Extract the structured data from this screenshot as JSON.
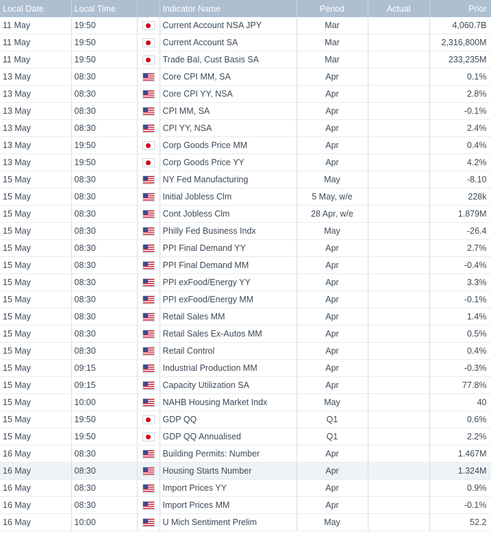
{
  "columns": {
    "date": "Local Date",
    "time": "Local Time",
    "name": "Indicator Name",
    "period": "Period",
    "actual": "Actual",
    "prior": "Prior"
  },
  "rows": [
    {
      "date": "11 May",
      "time": "19:50",
      "flag": "jp-flag-icon",
      "name": "Current Account NSA JPY",
      "period": "Mar",
      "actual": "",
      "prior": "4,060.7B"
    },
    {
      "date": "11 May",
      "time": "19:50",
      "flag": "jp-flag-icon",
      "name": "Current Account SA",
      "period": "Mar",
      "actual": "",
      "prior": "2,316,800M"
    },
    {
      "date": "11 May",
      "time": "19:50",
      "flag": "jp-flag-icon",
      "name": "Trade Bal, Cust Basis SA",
      "period": "Mar",
      "actual": "",
      "prior": "233,235M"
    },
    {
      "date": "13 May",
      "time": "08:30",
      "flag": "us-flag-icon",
      "name": "Core CPI MM, SA",
      "period": "Apr",
      "actual": "",
      "prior": "0.1%"
    },
    {
      "date": "13 May",
      "time": "08:30",
      "flag": "us-flag-icon",
      "name": "Core CPI YY, NSA",
      "period": "Apr",
      "actual": "",
      "prior": "2.8%"
    },
    {
      "date": "13 May",
      "time": "08:30",
      "flag": "us-flag-icon",
      "name": "CPI MM, SA",
      "period": "Apr",
      "actual": "",
      "prior": "-0.1%"
    },
    {
      "date": "13 May",
      "time": "08:30",
      "flag": "us-flag-icon",
      "name": "CPI YY, NSA",
      "period": "Apr",
      "actual": "",
      "prior": "2.4%"
    },
    {
      "date": "13 May",
      "time": "19:50",
      "flag": "jp-flag-icon",
      "name": "Corp Goods Price MM",
      "period": "Apr",
      "actual": "",
      "prior": "0.4%"
    },
    {
      "date": "13 May",
      "time": "19:50",
      "flag": "jp-flag-icon",
      "name": "Corp Goods Price YY",
      "period": "Apr",
      "actual": "",
      "prior": "4.2%"
    },
    {
      "date": "15 May",
      "time": "08:30",
      "flag": "us-flag-icon",
      "name": "NY Fed Manufacturing",
      "period": "May",
      "actual": "",
      "prior": "-8.10"
    },
    {
      "date": "15 May",
      "time": "08:30",
      "flag": "us-flag-icon",
      "name": "Initial Jobless Clm",
      "period": "5 May, w/e",
      "actual": "",
      "prior": "228k"
    },
    {
      "date": "15 May",
      "time": "08:30",
      "flag": "us-flag-icon",
      "name": "Cont Jobless Clm",
      "period": "28 Apr, w/e",
      "actual": "",
      "prior": "1.879M"
    },
    {
      "date": "15 May",
      "time": "08:30",
      "flag": "us-flag-icon",
      "approx": "≈",
      "name": "Philly Fed Business Indx",
      "period": "May",
      "actual": "",
      "prior": "-26.4"
    },
    {
      "date": "15 May",
      "time": "08:30",
      "flag": "us-flag-icon",
      "name": "PPI Final Demand YY",
      "period": "Apr",
      "actual": "",
      "prior": "2.7%"
    },
    {
      "date": "15 May",
      "time": "08:30",
      "flag": "us-flag-icon",
      "name": "PPI Final Demand MM",
      "period": "Apr",
      "actual": "",
      "prior": "-0.4%"
    },
    {
      "date": "15 May",
      "time": "08:30",
      "flag": "us-flag-icon",
      "name": "PPI exFood/Energy YY",
      "period": "Apr",
      "actual": "",
      "prior": "3.3%"
    },
    {
      "date": "15 May",
      "time": "08:30",
      "flag": "us-flag-icon",
      "name": "PPI exFood/Energy MM",
      "period": "Apr",
      "actual": "",
      "prior": "-0.1%"
    },
    {
      "date": "15 May",
      "time": "08:30",
      "flag": "us-flag-icon",
      "name": "Retail Sales MM",
      "period": "Apr",
      "actual": "",
      "prior": "1.4%"
    },
    {
      "date": "15 May",
      "time": "08:30",
      "flag": "us-flag-icon",
      "name": "Retail Sales Ex-Autos MM",
      "period": "Apr",
      "actual": "",
      "prior": "0.5%"
    },
    {
      "date": "15 May",
      "time": "08:30",
      "flag": "us-flag-icon",
      "name": "Retail Control",
      "period": "Apr",
      "actual": "",
      "prior": "0.4%"
    },
    {
      "date": "15 May",
      "time": "09:15",
      "flag": "us-flag-icon",
      "name": "Industrial Production MM",
      "period": "Apr",
      "actual": "",
      "prior": "-0.3%"
    },
    {
      "date": "15 May",
      "time": "09:15",
      "flag": "us-flag-icon",
      "name": "Capacity Utilization SA",
      "period": "Apr",
      "actual": "",
      "prior": "77.8%"
    },
    {
      "date": "15 May",
      "time": "10:00",
      "flag": "us-flag-icon",
      "name": "NAHB Housing Market Indx",
      "period": "May",
      "actual": "",
      "prior": "40"
    },
    {
      "date": "15 May",
      "time": "19:50",
      "flag": "jp-flag-icon",
      "name": "GDP QQ",
      "period": "Q1",
      "actual": "",
      "prior": "0.6%"
    },
    {
      "date": "15 May",
      "time": "19:50",
      "flag": "jp-flag-icon",
      "name": "GDP QQ Annualised",
      "period": "Q1",
      "actual": "",
      "prior": "2.2%"
    },
    {
      "date": "16 May",
      "time": "08:30",
      "flag": "us-flag-icon",
      "name": "Building Permits: Number",
      "period": "Apr",
      "actual": "",
      "prior": "1.467M"
    },
    {
      "date": "16 May",
      "time": "08:30",
      "flag": "us-flag-icon",
      "name": "Housing Starts Number",
      "period": "Apr",
      "actual": "",
      "prior": "1.324M",
      "highlight": true
    },
    {
      "date": "16 May",
      "time": "08:30",
      "flag": "us-flag-icon",
      "name": "Import Prices YY",
      "period": "Apr",
      "actual": "",
      "prior": "0.9%"
    },
    {
      "date": "16 May",
      "time": "08:30",
      "flag": "us-flag-icon",
      "name": "Import Prices MM",
      "period": "Apr",
      "actual": "",
      "prior": "-0.1%"
    },
    {
      "date": "16 May",
      "time": "10:00",
      "flag": "us-flag-icon",
      "name": "U Mich Sentiment Prelim",
      "period": "May",
      "actual": "",
      "prior": "52.2"
    }
  ]
}
